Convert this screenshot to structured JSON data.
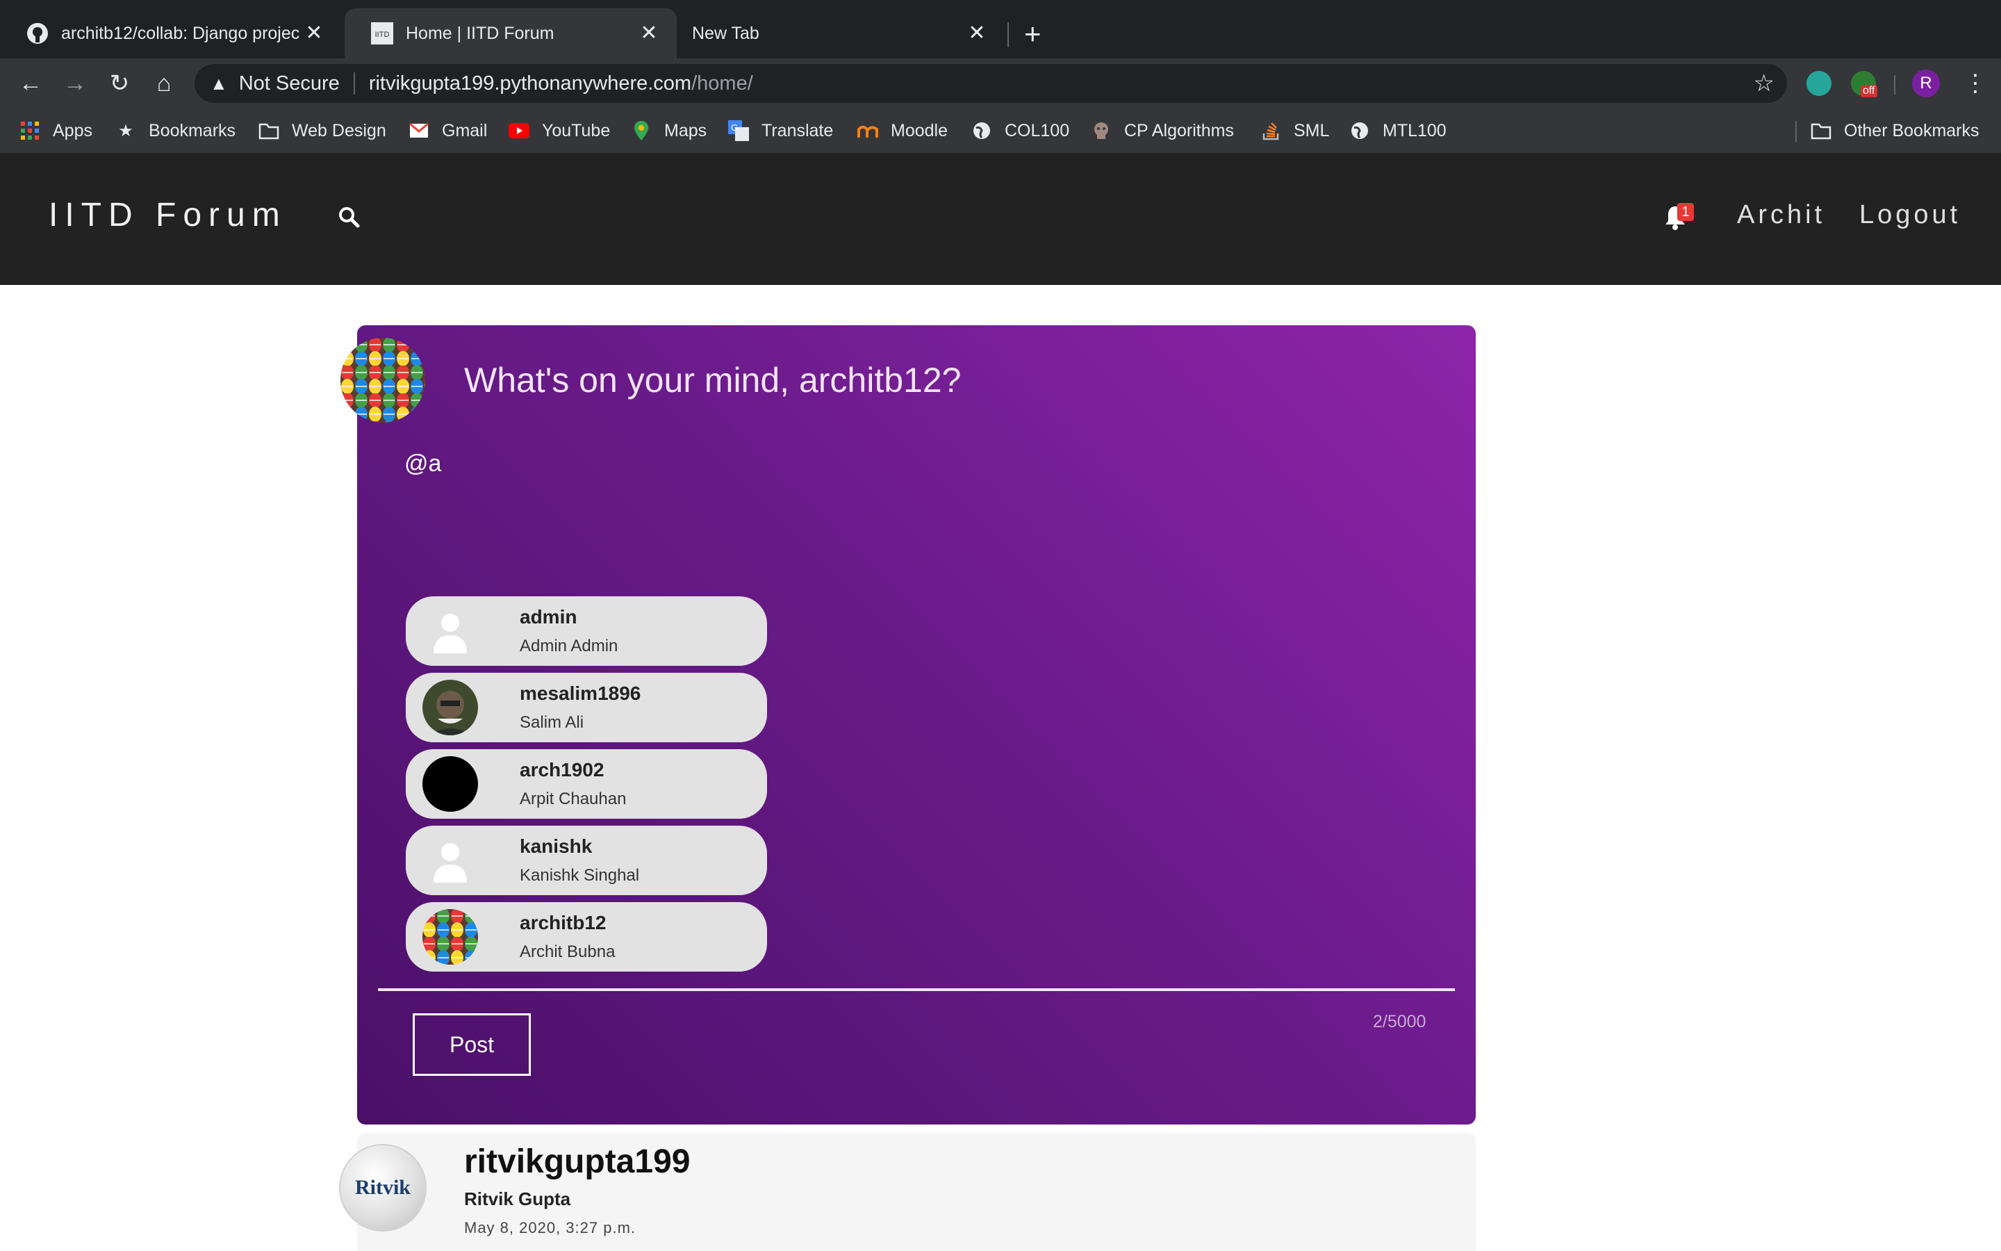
{
  "browser": {
    "tabs": [
      {
        "label": "architb12/collab: Django projec",
        "icon": "github-icon"
      },
      {
        "label": "Home | IITD Forum",
        "icon": "iitd-favicon"
      },
      {
        "label": "New Tab",
        "icon": ""
      }
    ],
    "address": {
      "security": "Not Secure",
      "host": "ritvikgupta199.pythonanywhere.com",
      "path": "/home/"
    },
    "extension_badge": "off",
    "profile_initial": "R",
    "bookmarks": [
      {
        "label": "Apps",
        "icon": "apps-grid-icon"
      },
      {
        "label": "Bookmarks",
        "icon": "star-icon"
      },
      {
        "label": "Web Design",
        "icon": "folder-icon"
      },
      {
        "label": "Gmail",
        "icon": "gmail-icon"
      },
      {
        "label": "YouTube",
        "icon": "youtube-icon"
      },
      {
        "label": "Maps",
        "icon": "maps-icon"
      },
      {
        "label": "Translate",
        "icon": "translate-icon"
      },
      {
        "label": "Moodle",
        "icon": "moodle-icon"
      },
      {
        "label": "COL100",
        "icon": "globe-icon"
      },
      {
        "label": "CP Algorithms",
        "icon": "cp-icon"
      },
      {
        "label": "SML",
        "icon": "stack-icon"
      },
      {
        "label": "MTL100",
        "icon": "globe-icon"
      }
    ],
    "other_bookmarks": "Other Bookmarks"
  },
  "site": {
    "brand": "IITD Forum",
    "notification_count": "1",
    "user_link": "Archit",
    "logout_link": "Logout"
  },
  "composer": {
    "prompt": "What's on your mind, architb12?",
    "typed_text": "@a",
    "counter": "2/5000",
    "post_label": "Post",
    "suggestions": [
      {
        "username": "admin",
        "full_name": "Admin Admin",
        "avatar": "default"
      },
      {
        "username": "mesalim1896",
        "full_name": "Salim Ali",
        "avatar": "photo"
      },
      {
        "username": "arch1902",
        "full_name": "Arpit Chauhan",
        "avatar": "black"
      },
      {
        "username": "kanishk",
        "full_name": "Kanishk Singhal",
        "avatar": "default"
      },
      {
        "username": "architb12",
        "full_name": "Archit Bubna",
        "avatar": "eggs"
      }
    ]
  },
  "feed": {
    "post": {
      "avatar_text": "Ritvik",
      "username": "ritvikgupta199",
      "full_name": "Ritvik Gupta",
      "date": "May 8, 2020, 3:27 p.m."
    }
  },
  "colors": {
    "card_gradient_start": "#8e24aa",
    "card_gradient_end": "#4a1068",
    "header_bg": "#222222",
    "chrome_bg": "#202124"
  }
}
